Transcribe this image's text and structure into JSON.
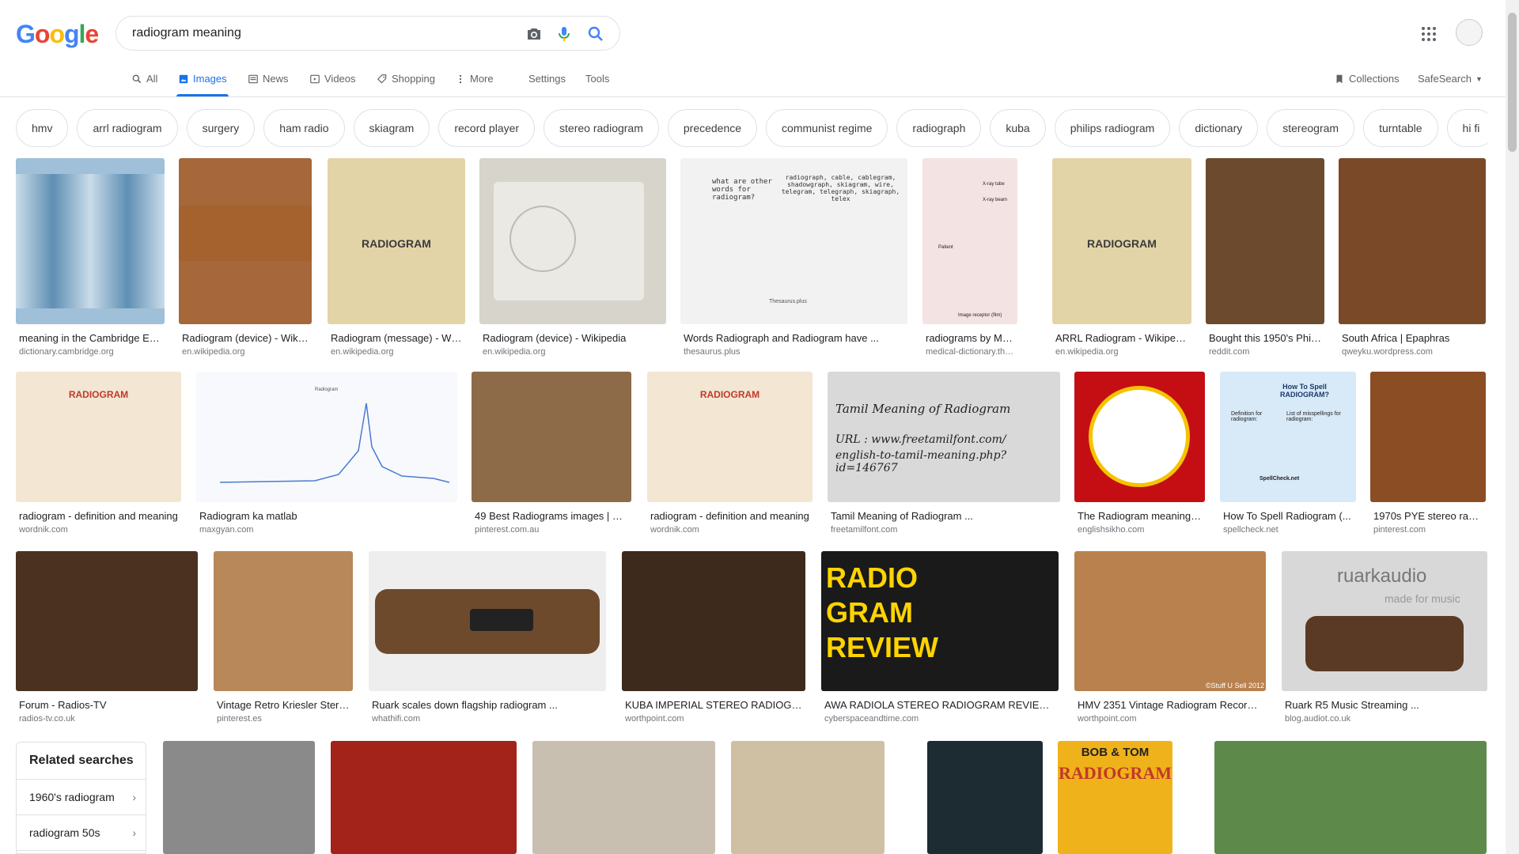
{
  "header": {
    "logo_letters": [
      {
        "ch": "G",
        "color": "#4285f4"
      },
      {
        "ch": "o",
        "color": "#ea4335"
      },
      {
        "ch": "o",
        "color": "#fbbc05"
      },
      {
        "ch": "g",
        "color": "#4285f4"
      },
      {
        "ch": "l",
        "color": "#34a853"
      },
      {
        "ch": "e",
        "color": "#ea4335"
      }
    ],
    "query": "radiogram meaning",
    "icons": [
      "camera-icon",
      "microphone-icon",
      "search-icon",
      "apps-grid-icon",
      "avatar"
    ]
  },
  "tabs": [
    {
      "label": "All",
      "icon": "search-icon",
      "active": false
    },
    {
      "label": "Images",
      "icon": "image-icon",
      "active": true
    },
    {
      "label": "News",
      "icon": "news-icon",
      "active": false
    },
    {
      "label": "Videos",
      "icon": "video-icon",
      "active": false
    },
    {
      "label": "Shopping",
      "icon": "tag-icon",
      "active": false
    },
    {
      "label": "More",
      "icon": "dots-icon",
      "active": false
    },
    {
      "label": "Settings",
      "active": false
    },
    {
      "label": "Tools",
      "active": false
    }
  ],
  "right_links": {
    "collections": "Collections",
    "safesearch": "SafeSearch"
  },
  "chips": [
    "hmv",
    "arrl radiogram",
    "surgery",
    "ham radio",
    "skiagram",
    "record player",
    "stereo radiogram",
    "precedence",
    "communist regime",
    "radiograph",
    "kuba",
    "philips radiogram",
    "dictionary",
    "stereogram",
    "turntable",
    "hi fi"
  ],
  "rows": [
    [
      {
        "title": "meaning in the Cambridge En...",
        "src": "dictionary.cambridge.org",
        "color": "#9fc0d8"
      },
      {
        "title": "Radiogram (device) - Wiki...",
        "src": "en.wikipedia.org",
        "color": "#a6683a"
      },
      {
        "title": "Radiogram (message) - Wi...",
        "src": "en.wikipedia.org",
        "color": "#e3d4a8"
      },
      {
        "title": "Radiogram (device) - Wikipedia",
        "src": "en.wikipedia.org",
        "color": "#d7d4cc"
      },
      {
        "title": "Words Radiograph and Radiogram have ...",
        "src": "thesaurus.plus",
        "color": "#f2f2f2"
      },
      {
        "title": "radiograms by Medical...",
        "src": "medical-dictionary.thefre...",
        "color": "#f4e3e3"
      },
      {
        "title": "ARRL Radiogram - Wikipedia",
        "src": "en.wikipedia.org",
        "color": "#e3d4a8"
      },
      {
        "title": "Bought this 1950's Phil...",
        "src": "reddit.com",
        "color": "#6b4a2e"
      },
      {
        "title": "South Africa | Epaphras",
        "src": "qweyku.wordpress.com",
        "color": "#7a4a28"
      }
    ],
    [
      {
        "title": "radiogram - definition and meaning",
        "src": "wordnik.com",
        "color": "#f3e6d3"
      },
      {
        "title": "Radiogram ka matlab",
        "src": "maxgyan.com",
        "color": "#f7f9fc"
      },
      {
        "title": "49 Best Radiograms images | Vi...",
        "src": "pinterest.com.au",
        "color": "#8d6a48"
      },
      {
        "title": "radiogram - definition and meaning",
        "src": "wordnik.com",
        "color": "#f3e6d3"
      },
      {
        "title": "Tamil Meaning of Radiogram ...",
        "src": "freetamilfont.com",
        "color": "#d9d9d9"
      },
      {
        "title": "The Radiogram meaning i...",
        "src": "englishsikho.com",
        "color": "#c40e14"
      },
      {
        "title": "How To Spell Radiogram (...",
        "src": "spellcheck.net",
        "color": "#d8e9f7"
      },
      {
        "title": "1970s PYE stereo radi...",
        "src": "pinterest.com",
        "color": "#8b4d23"
      }
    ],
    [
      {
        "title": "Forum - Radios-TV",
        "src": "radios-tv.co.uk",
        "color": "#4b3220"
      },
      {
        "title": "Vintage Retro Kriesler Stere...",
        "src": "pinterest.es",
        "color": "#b8875a"
      },
      {
        "title": "Ruark scales down flagship radiogram ...",
        "src": "whathifi.com",
        "color": "#eeeeee"
      },
      {
        "title": "KUBA IMPERIAL STEREO RADIOGR...",
        "src": "worthpoint.com",
        "color": "#3d2a1c"
      },
      {
        "title": "AWA RADIOLA STEREO RADIOGRAM REVIEW b...",
        "src": "cyberspaceandtime.com",
        "color": "#1a1a1a"
      },
      {
        "title": "HMV 2351 Vintage Radiogram Record ...",
        "src": "worthpoint.com",
        "color": "#b9814d"
      },
      {
        "title": "Ruark R5 Music Streaming ...",
        "src": "blog.audiot.co.uk",
        "color": "#d8d8d8"
      }
    ],
    [
      {
        "color": "#8a8a8a"
      },
      {
        "color": "#a3221a"
      },
      {
        "color": "#c9bfb0"
      },
      {
        "color": "#cfbfa3"
      },
      {
        "color": "#1d2b33"
      },
      {
        "color": "#f0b21a"
      },
      {
        "color": "#5d8a4a"
      }
    ]
  ],
  "thumb_text": {
    "radiogram_form": "RADIOGRAM",
    "tamil_line1": "Tamil Meaning of Radiogram",
    "tamil_line2": "URL : www.freetamilfont.com/",
    "tamil_line3": "english-to-tamil-meaning.php?id=146767",
    "review_text": "RADIO GRAM REVIEW",
    "ruark_text": "ruarkaudio",
    "ruark_tagline": "made for music",
    "bob_tom_top": "BOB & TOM",
    "bob_tom_big": "RADIOGRAM",
    "pigeon_q": "what are other words for radiogram?",
    "pigeon_a": "radiograph, cable, cablegram, shadowgraph, skiagram, wire, telegram, telegraph, skiagraph, telex",
    "thesaurus_label": "Thesaurus.plus",
    "spell_title": "How To Spell RADIOGRAM?",
    "spell_def": "Definition for radiogram:",
    "spell_list": "List of misspellings for radiogram:",
    "spell_brand": "SpellCheck.net",
    "stuff_credit": "©Stuff U Sell 2012",
    "xray_tube": "X-ray tube",
    "xray_beam": "X-ray beam",
    "patient": "Patient",
    "receptor": "Image receptor (film)",
    "chart_legend": "Radiogram"
  },
  "related": {
    "title": "Related searches",
    "items": [
      "1960's radiogram",
      "radiogram 50s"
    ]
  }
}
